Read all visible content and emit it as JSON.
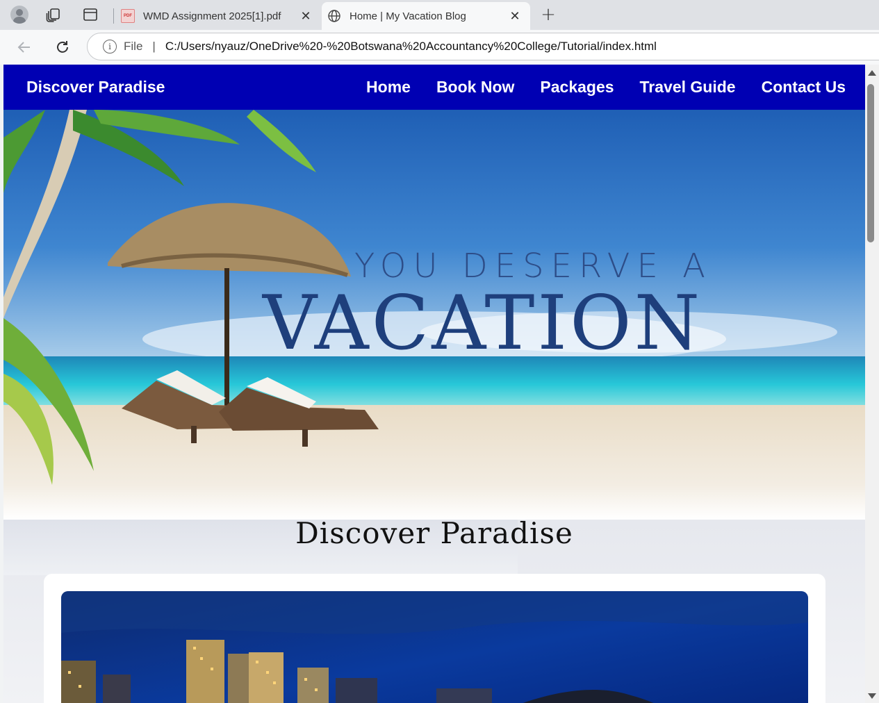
{
  "browser": {
    "tabs": [
      {
        "title": "WMD Assignment 2025[1].pdf",
        "icon": "pdf-icon",
        "active": false
      },
      {
        "title": "Home | My Vacation Blog",
        "icon": "globe-icon",
        "active": true
      }
    ],
    "address": {
      "scheme": "File",
      "url": "C:/Users/nyauz/OneDrive%20-%20Botswana%20Accountancy%20College/Tutorial/index.html"
    }
  },
  "site": {
    "brand": "Discover Paradise",
    "nav": [
      "Home",
      "Book Now",
      "Packages",
      "Travel Guide",
      "Contact Us"
    ],
    "hero": {
      "line1": "YOU DESERVE A",
      "line2": "VACATION"
    },
    "section_title": "Discover Paradise"
  },
  "colors": {
    "navbar": "#0000b3",
    "sky": "#2f74c6",
    "sea": "#27c7d8",
    "sand": "#efe6d8",
    "hero_text": "#1e3f7c"
  }
}
